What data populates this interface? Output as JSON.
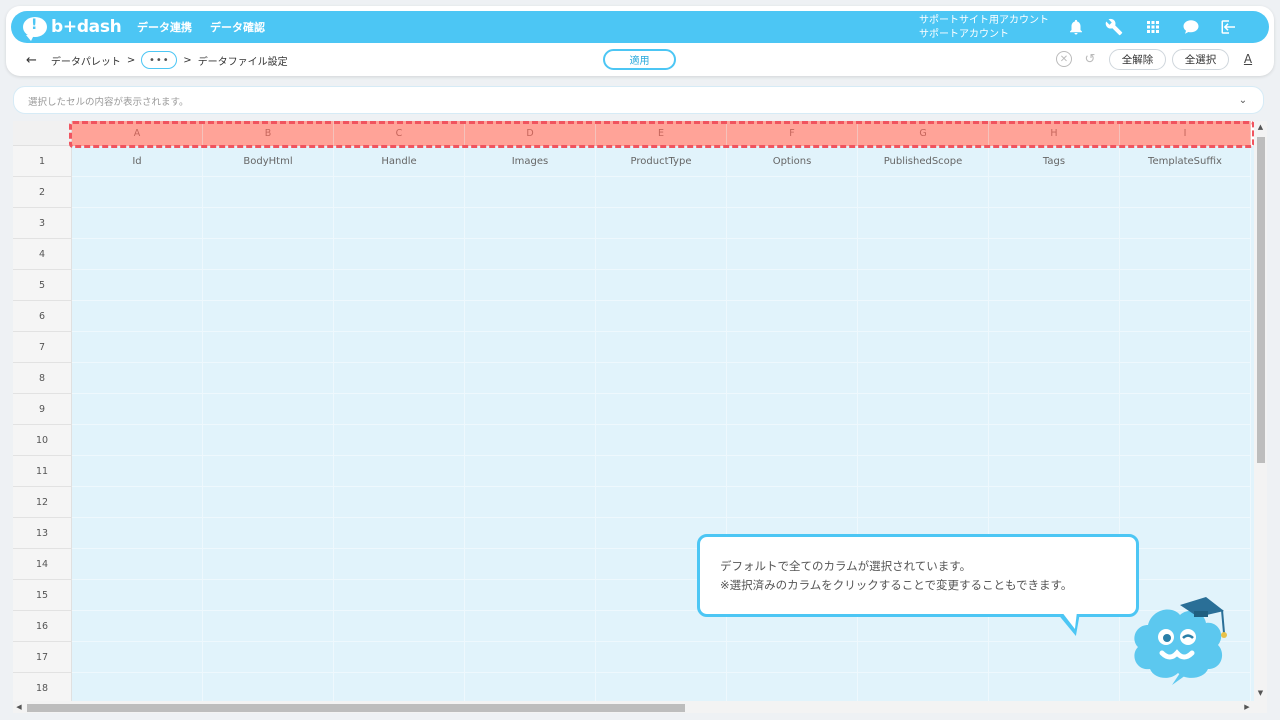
{
  "header": {
    "logo_text": "b+dash",
    "nav": [
      "データ連携",
      "データ確認"
    ],
    "account_line1": "サポートサイト用アカウント",
    "account_line2": "サポートアカウント"
  },
  "breadcrumb": {
    "back": "←",
    "item1": "データパレット",
    "sep": ">",
    "ellipsis": "•••",
    "current": "データファイル設定"
  },
  "toolbar": {
    "apply_label": "適用",
    "clear_all_label": "全解除",
    "select_all_label": "全選択",
    "font_label": "A"
  },
  "cellbar": {
    "placeholder": "選択したセルの内容が表示されます。"
  },
  "grid": {
    "columns": [
      "A",
      "B",
      "C",
      "D",
      "E",
      "F",
      "G",
      "H",
      "I"
    ],
    "rows": [
      "1",
      "2",
      "3",
      "4",
      "5",
      "6",
      "7",
      "8",
      "9",
      "10",
      "11",
      "12",
      "13",
      "14",
      "15",
      "16",
      "17",
      "18"
    ],
    "header_row": [
      "Id",
      "BodyHtml",
      "Handle",
      "Images",
      "ProductType",
      "Options",
      "PublishedScope",
      "Tags",
      "TemplateSuffix"
    ]
  },
  "tooltip": {
    "line1": "デフォルトで全てのカラムが選択されています。",
    "line2": "※選択済みのカラムをクリックすることで変更することもできます。"
  },
  "colors": {
    "brand": "#4cc6f4",
    "selected_column": "#ffa398",
    "selection_outline": "#f0545f",
    "cell_bg": "#e1f3fb"
  },
  "icons": [
    "bell-icon",
    "wrench-icon",
    "grid-apps-icon",
    "chat-bubble-icon",
    "logout-icon",
    "clear-circle-icon",
    "history-icon",
    "chevron-down-icon"
  ]
}
